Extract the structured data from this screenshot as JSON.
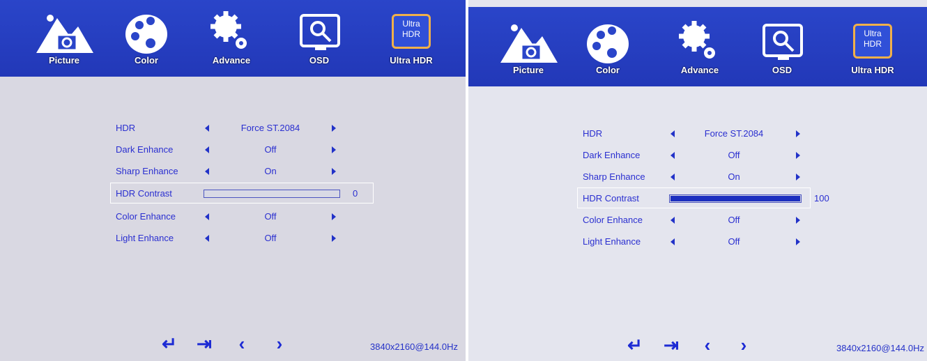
{
  "tabs": [
    {
      "label": "Picture",
      "icon": "picture-icon"
    },
    {
      "label": "Color",
      "icon": "color-palette-icon"
    },
    {
      "label": "Advance",
      "icon": "gear-icon"
    },
    {
      "label": "OSD",
      "icon": "monitor-search-icon"
    },
    {
      "label": "Ultra HDR",
      "icon": "ultra-hdr-icon",
      "icon_text": "Ultra\nHDR",
      "active": true
    }
  ],
  "left_menu": {
    "rows": [
      {
        "name": "HDR",
        "value": "Force ST.2084"
      },
      {
        "name": "Dark Enhance",
        "value": "Off"
      },
      {
        "name": "Sharp Enhance",
        "value": "On"
      },
      {
        "name": "HDR Contrast",
        "value": "0",
        "bar_level": 0
      },
      {
        "name": "Color Enhance",
        "value": "Off"
      },
      {
        "name": "Light Enhance",
        "value": "Off"
      }
    ]
  },
  "right_menu": {
    "rows": [
      {
        "name": "HDR",
        "value": "Force ST.2084"
      },
      {
        "name": "Dark Enhance",
        "value": "Off"
      },
      {
        "name": "Sharp Enhance",
        "value": "On"
      },
      {
        "name": "HDR Contrast",
        "value": "100",
        "bar_level": 100
      },
      {
        "name": "Color Enhance",
        "value": "Off"
      },
      {
        "name": "Light Enhance",
        "value": "Off"
      }
    ]
  },
  "bottom_icons": [
    {
      "name": "enter-icon",
      "glyph": "↵"
    },
    {
      "name": "exit-icon",
      "glyph": "⇥"
    },
    {
      "name": "left-arrow-icon",
      "glyph": "‹"
    },
    {
      "name": "right-arrow-icon",
      "glyph": "›"
    }
  ],
  "status": {
    "resolution": "3840x2160@144.0Hz"
  },
  "colors": {
    "topbar": "#2a45c9",
    "text": "#2a2fd0",
    "bar_fill": "#1c2fbf",
    "ultra_hdr_border": "#f0b04a"
  }
}
